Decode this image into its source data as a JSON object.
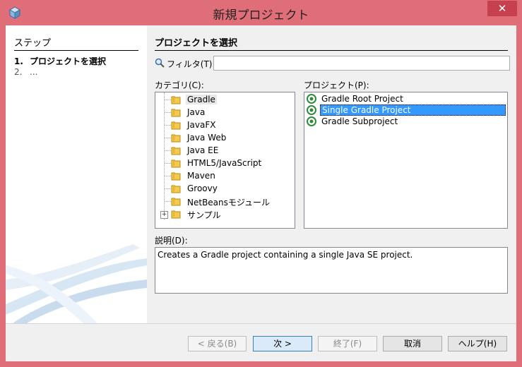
{
  "window": {
    "title": "新規プロジェクト",
    "close_label": "✕"
  },
  "steps": {
    "heading": "ステップ",
    "items": [
      {
        "num": "1.",
        "label": "プロジェクトを選択"
      },
      {
        "num": "2.",
        "label": "..."
      }
    ]
  },
  "main": {
    "section_title": "プロジェクトを選択",
    "filter": {
      "label": "フィルタ(T):",
      "value": ""
    },
    "categories_label": "カテゴリ(C):",
    "categories": [
      {
        "label": "Gradle",
        "selected": true
      },
      {
        "label": "Java"
      },
      {
        "label": "JavaFX"
      },
      {
        "label": "Java Web"
      },
      {
        "label": "Java EE"
      },
      {
        "label": "HTML5/JavaScript"
      },
      {
        "label": "Maven"
      },
      {
        "label": "Groovy"
      },
      {
        "label": "NetBeansモジュール"
      },
      {
        "label": "サンプル",
        "expandable": true,
        "expander": "+"
      }
    ],
    "projects_label": "プロジェクト(P):",
    "projects": [
      {
        "label": "Gradle Root Project"
      },
      {
        "label": "Single Gradle Project",
        "selected": true
      },
      {
        "label": "Gradle Subproject"
      }
    ],
    "description_label": "説明(D):",
    "description": "Creates a Gradle project containing a single Java SE project."
  },
  "buttons": {
    "back": "< 戻る(B)",
    "next": "次 >",
    "finish": "終了(F)",
    "cancel": "取消",
    "help": "ヘルプ(H)"
  },
  "colors": {
    "title_bar": "#e06e78",
    "close_button": "#c7404f",
    "selection": "#3399ff"
  }
}
